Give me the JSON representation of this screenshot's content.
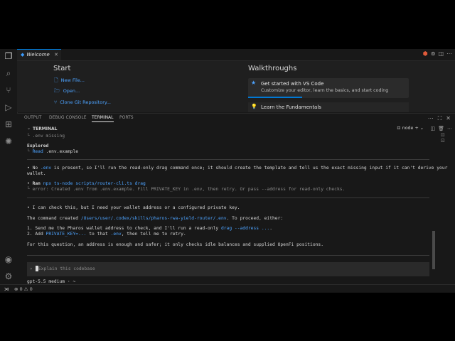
{
  "tab": {
    "title": "Welcome",
    "close": "✕"
  },
  "welcome": {
    "start_heading": "Start",
    "start_items": [
      {
        "icon": "new-file-icon",
        "glyph": "🗋",
        "label": "New File..."
      },
      {
        "icon": "open-folder-icon",
        "glyph": "🗁",
        "label": "Open..."
      },
      {
        "icon": "git-clone-icon",
        "glyph": "⑂",
        "label": "Clone Git Repository..."
      }
    ],
    "walkthroughs_heading": "Walkthroughs",
    "walk_card": {
      "title": "Get started with VS Code",
      "subtitle": "Customize your editor, learn the basics, and start coding"
    },
    "walk_item": {
      "title": "Learn the Fundamentals"
    }
  },
  "panel": {
    "tabs": [
      "OUTPUT",
      "DEBUG CONSOLE",
      "TERMINAL",
      "PORTS"
    ],
    "active_tab": "TERMINAL",
    "terminal_label": "TERMINAL",
    "shell": "node"
  },
  "terminal": {
    "l1": "└ .env missing",
    "l2": "Explored",
    "l3_prefix": "└ ",
    "l3_cmd": "Read",
    "l3_rest": " .env.example",
    "p1_a": "• No ",
    "p1_b": ".env",
    "p1_c": " is present, so I'll run the read-only drag command once; it should create the template and tell us the exact missing input if it can't derive your",
    "p1_d": "  wallet.",
    "ran_bullet": "• ",
    "ran_label": "Ran",
    "ran_cmd": " npx ts-node scripts/router-cli.ts drag",
    "ran_err": "  └ error: Created .env from .env.example. Fill PRIVATE_KEY in .env, then retry. Or pass --address for read-only checks.",
    "q1": "• I can check this, but I need your wallet address or a configured private key.",
    "q2_a": "  The command created ",
    "q2_b": "/Users/user/.codex/skills/pharos-rwa-yield-router/.env",
    "q2_c": ". To proceed, either:",
    "o1_a": "  1. Send me the Pharos wallet address to check, and I'll run a read-only ",
    "o1_b": "drag --address ...",
    "o1_c": ".",
    "o2_a": "  2. Add ",
    "o2_b": "PRIVATE_KEY=...",
    "o2_c": " to that ",
    "o2_d": ".env",
    "o2_e": ", then tell me to retry.",
    "q3": "  For this question, an address is enough and safer; it only checks idle balances and supplied OpenFi positions.",
    "prompt_symbol": "›",
    "placeholder": "Explain this codebase",
    "model": "  gpt-5.5 medium · ~"
  },
  "status": {
    "errors": "⊗ 0 ⚠ 0"
  }
}
